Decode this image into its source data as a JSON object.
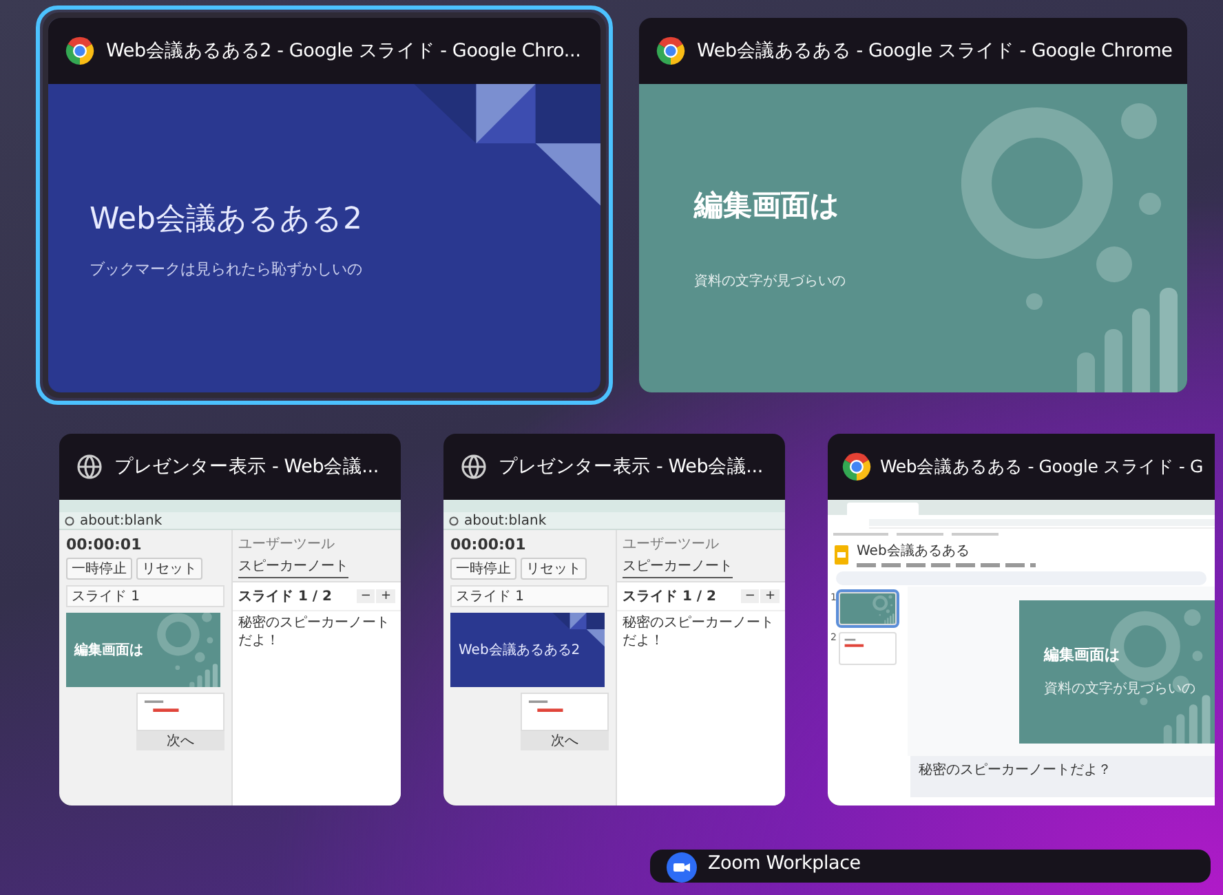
{
  "windows": [
    {
      "kind": "slide",
      "selected": true,
      "title": "Web会議あるある2 - Google スライド - Google Chro...",
      "slide": {
        "kind": "blue",
        "title": "Web会議あるある2",
        "subtitle": "ブックマークは見られたら恥ずかしいの"
      }
    },
    {
      "kind": "slide",
      "selected": false,
      "title": "Web会議あるある - Google スライド - Google Chrome",
      "slide": {
        "kind": "teal",
        "title": "編集画面は",
        "subtitle": "資料の文字が見づらいの"
      }
    },
    {
      "kind": "presenter",
      "selected": false,
      "title": "プレゼンター表示 - Web会議...",
      "presenter": {
        "address": "about:blank",
        "timer": "00:00:01",
        "buttons": [
          "一時停止",
          "リセット"
        ],
        "slide_select": "スライド 1",
        "current_slide": {
          "kind": "teal",
          "title": "編集画面は"
        },
        "next_label": "次へ",
        "tabs": [
          {
            "label": "ユーザーツール",
            "selected": false
          },
          {
            "label": "スピーカーノート",
            "selected": true
          }
        ],
        "counter": "スライド 1 / 2",
        "zoom_buttons": [
          "−",
          "+"
        ],
        "notes": "秘密のスピーカーノートだよ！"
      }
    },
    {
      "kind": "presenter",
      "selected": false,
      "title": "プレゼンター表示 - Web会議...",
      "presenter": {
        "address": "about:blank",
        "timer": "00:00:01",
        "buttons": [
          "一時停止",
          "リセット"
        ],
        "slide_select": "スライド 1",
        "current_slide": {
          "kind": "blue",
          "title": "Web会議あるある2"
        },
        "next_label": "次へ",
        "tabs": [
          {
            "label": "ユーザーツール",
            "selected": false
          },
          {
            "label": "スピーカーノート",
            "selected": true
          }
        ],
        "counter": "スライド 1 / 2",
        "zoom_buttons": [
          "−",
          "+"
        ],
        "notes": "秘密のスピーカーノートだよ！"
      }
    },
    {
      "kind": "editor",
      "selected": false,
      "title": "Web会議あるある - Google スライド - G",
      "editor": {
        "doc_title": "Web会議あるある",
        "filmstrip": [
          {
            "number": "1",
            "selected": true,
            "kind": "teal"
          },
          {
            "number": "2",
            "selected": false,
            "kind": "white"
          }
        ],
        "slide": {
          "kind": "teal",
          "title": "編集画面は",
          "subtitle": "資料の文字が見づらいの"
        },
        "notes": "秘密のスピーカーノートだよ？"
      }
    },
    {
      "kind": "app",
      "selected": false,
      "title": "Zoom Workplace"
    }
  ]
}
